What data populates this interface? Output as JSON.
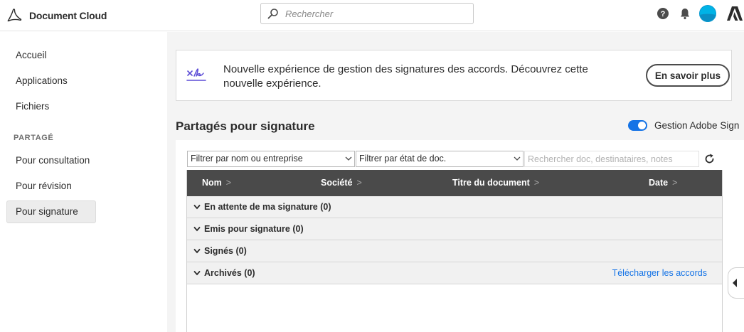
{
  "app": {
    "name": "Document Cloud",
    "search_placeholder": "Rechercher",
    "icons": [
      "acrobat-logo-icon",
      "search-icon",
      "help-icon",
      "bell-icon",
      "avatar",
      "adobe-logo-icon"
    ]
  },
  "sidebar": {
    "items": [
      {
        "label": "Accueil"
      },
      {
        "label": "Applications"
      },
      {
        "label": "Fichiers"
      }
    ],
    "section_label": "PARTAGÉ",
    "shared_items": [
      {
        "label": "Pour consultation"
      },
      {
        "label": "Pour révision"
      },
      {
        "label": "Pour signature",
        "active": true
      }
    ]
  },
  "banner": {
    "text": "Nouvelle expérience de gestion des signatures des accords. Découvrez cette nouvelle expérience.",
    "button_label": "En savoir plus"
  },
  "section": {
    "title": "Partagés pour signature",
    "toggle_label": "Gestion Adobe Sign",
    "toggle_on": true
  },
  "filters": {
    "by_name": "Filtrer par nom ou entreprise",
    "by_state": "Filtrer par état de doc.",
    "search_placeholder": "Rechercher doc, destinataires, notes"
  },
  "table": {
    "columns": [
      "Nom",
      "Société",
      "Titre du document",
      "Date"
    ],
    "groups": [
      {
        "label": "En attente de ma signature (0)"
      },
      {
        "label": "Emis pour signature (0)"
      },
      {
        "label": "Signés (0)"
      },
      {
        "label": "Archivés (0)",
        "link": "Télécharger les accords"
      }
    ]
  },
  "colors": {
    "accent": "#1473e6",
    "header_bg": "#4a4a4a",
    "main_bg": "#f4f4f4"
  }
}
